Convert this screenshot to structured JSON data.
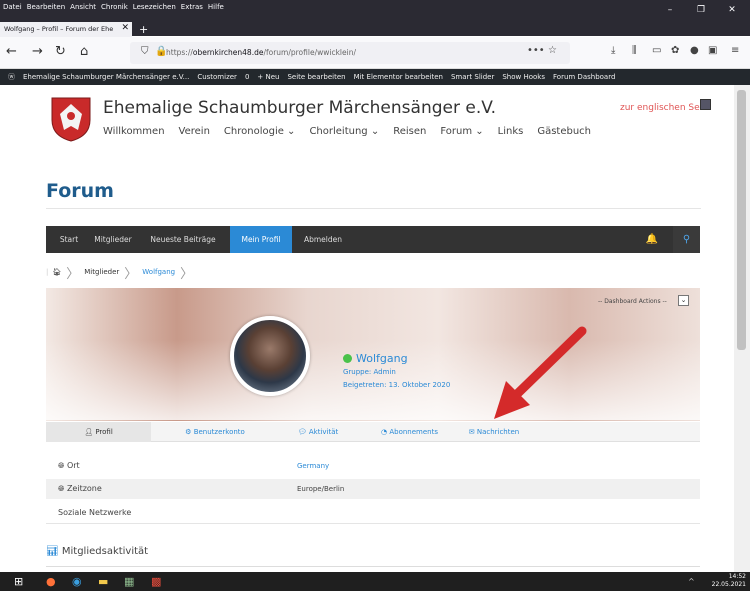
{
  "browser": {
    "menu": [
      "Datei",
      "Bearbeiten",
      "Ansicht",
      "Chronik",
      "Lesezeichen",
      "Extras",
      "Hilfe"
    ],
    "tab_title": "Wolfgang – Profil – Forum der Ehe",
    "url_prefix": "https://",
    "url_host": "obernkirchen48.de",
    "url_path": "/forum/profile/wwicklein/",
    "window_controls": [
      "–",
      "❐",
      "✕"
    ]
  },
  "wp_admin_bar": {
    "items": [
      "Ehemalige Schaumburger Märchensänger e.V...",
      "Customizer",
      "0",
      "+ Neu",
      "Seite bearbeiten",
      "Mit Elementor bearbeiten",
      "Smart Slider",
      "Show Hooks",
      "Forum Dashboard"
    ]
  },
  "site": {
    "title": "Ehemalige Schaumburger Märchensänger e.V.",
    "nav": [
      "Willkommen",
      "Verein",
      "Chronologie ⌄",
      "Chorleitung ⌄",
      "Reisen",
      "Forum ⌄",
      "Links",
      "Gästebuch"
    ],
    "english_link": "zur englischen Seite"
  },
  "forum": {
    "title": "Forum",
    "nav": [
      "Start",
      "Mitglieder",
      "Neueste Beiträge",
      "Mein Profil",
      "Abmelden"
    ],
    "breadcrumb": [
      "Mitglieder",
      "Wolfgang"
    ]
  },
  "profile": {
    "dashboard_actions": "-- Dashboard Actions --",
    "name": "Wolfgang",
    "group": "Gruppe: Admin",
    "joined": "Beigetreten: 13. Oktober 2020",
    "tabs": [
      "Profil",
      "Benutzerkonto",
      "Aktivität",
      "Abonnements",
      "Nachrichten"
    ],
    "fields": [
      {
        "label": "Ort",
        "value": "Germany"
      },
      {
        "label": "Zeitzone",
        "value": "Europe/Berlin"
      },
      {
        "label": "Soziale Netzwerke",
        "value": ""
      }
    ],
    "activity_heading": "Mitgliedsaktivität"
  },
  "taskbar": {
    "time": "14:52",
    "date": "22.05.2021"
  },
  "colors": {
    "accent": "#2b8ad6",
    "nav_dark": "#333333",
    "arrow": "#d42a2a",
    "title": "#1f5c8c"
  }
}
